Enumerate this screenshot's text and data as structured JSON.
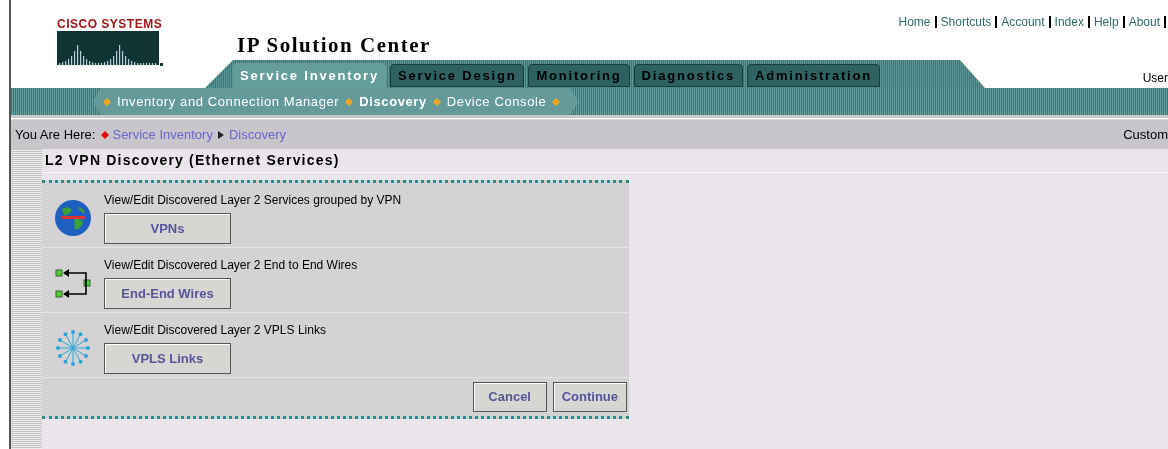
{
  "logo": {
    "wordmark": "CISCO SYSTEMS"
  },
  "app_title": "IP Solution Center",
  "top_links": [
    {
      "label": "Home"
    },
    {
      "label": "Shortcuts"
    },
    {
      "label": "Account"
    },
    {
      "label": "Index"
    },
    {
      "label": "Help"
    },
    {
      "label": "About"
    }
  ],
  "user_label": "User",
  "tabs": [
    {
      "label": "Service Inventory",
      "selected": true
    },
    {
      "label": "Service Design",
      "selected": false
    },
    {
      "label": "Monitoring",
      "selected": false
    },
    {
      "label": "Diagnostics",
      "selected": false
    },
    {
      "label": "Administration",
      "selected": false
    }
  ],
  "sub_nav": [
    {
      "label": "Inventory and Connection Manager",
      "selected": false
    },
    {
      "label": "Discovery",
      "selected": true
    },
    {
      "label": "Device Console",
      "selected": false
    }
  ],
  "breadcrumb": {
    "prefix": "You Are Here:",
    "items": [
      "Service Inventory",
      "Discovery"
    ],
    "right_text": "Custom"
  },
  "page_title": "L2 VPN Discovery (Ethernet Services)",
  "options": [
    {
      "kind": "globe",
      "description": "View/Edit Discovered Layer 2 Services grouped by VPN",
      "button": "VPNs"
    },
    {
      "kind": "wires",
      "description": "View/Edit Discovered Layer 2 End to End Wires",
      "button": "End-End Wires"
    },
    {
      "kind": "vpls",
      "description": "View/Edit Discovered Layer 2 VPLS Links",
      "button": "VPLS Links"
    }
  ],
  "footer_buttons": [
    "Cancel",
    "Continue"
  ]
}
